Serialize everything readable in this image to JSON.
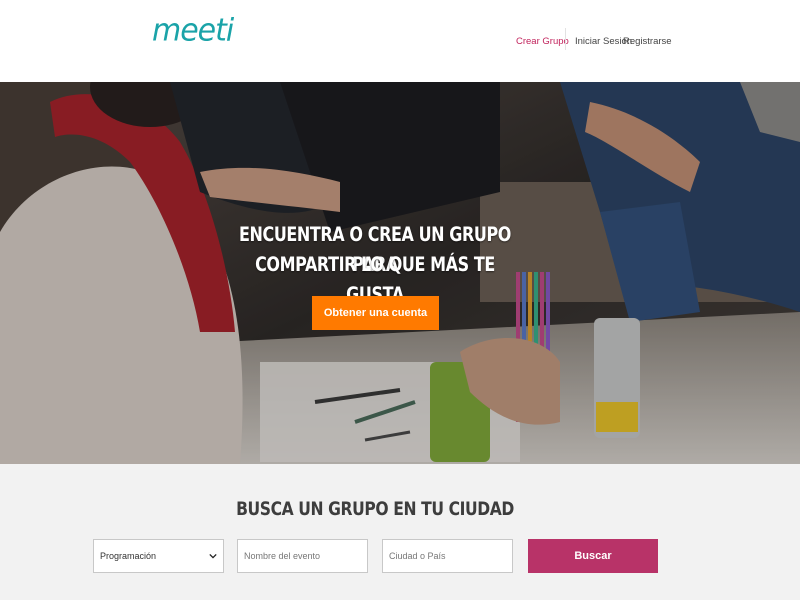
{
  "header": {
    "logo": "meeti",
    "nav": {
      "create_group": "Crear Grupo",
      "login": "Iniciar Sesión",
      "register": "Registrarse"
    }
  },
  "hero": {
    "title_line1": "ENCUENTRA O CREA UN GRUPO PARA",
    "title_line2": "COMPARTIR LO QUE MÁS TE GUSTA",
    "cta_label": "Obtener una cuenta"
  },
  "search": {
    "title": "BUSCA UN GRUPO EN TU CIUDAD",
    "category_selected": "Programación",
    "event_placeholder": "Nombre del evento",
    "city_placeholder": "Ciudad o País",
    "button_label": "Buscar"
  },
  "colors": {
    "brand": "#1aa3a8",
    "nav_active": "#c2245d",
    "cta": "#ff7a00",
    "search_button": "#b83368"
  },
  "icons": [
    "chevron-down-icon"
  ]
}
